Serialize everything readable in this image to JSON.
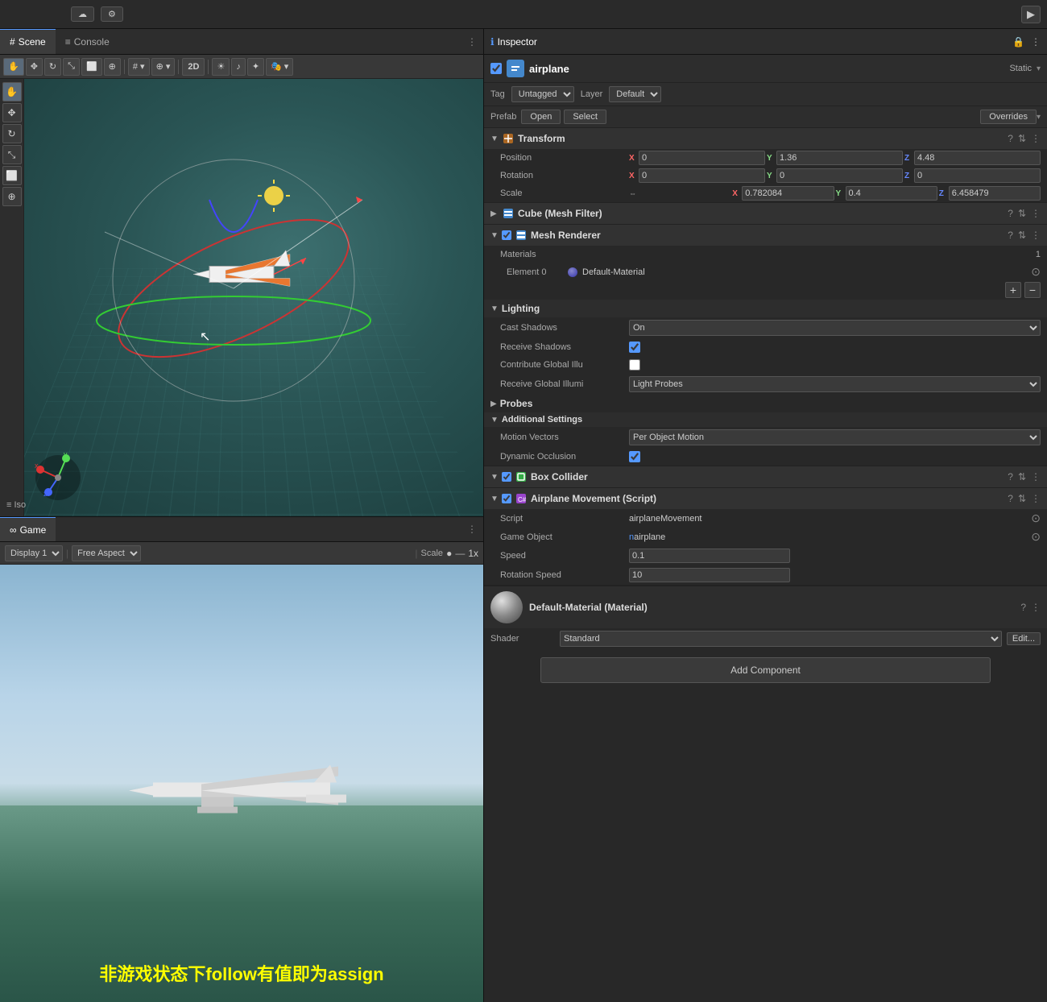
{
  "topbar": {
    "cloud_label": "☁",
    "gear_label": "⚙",
    "play_label": "▶"
  },
  "scene_tab": {
    "scene_label": "Scene",
    "console_label": "Console",
    "more_label": "⋮"
  },
  "scene_toolbar": {
    "hand_tool": "✋",
    "move_tool": "✥",
    "rotate_tool": "↻",
    "scale_tool": "⤡",
    "rect_tool": "⬜",
    "transform_tool": "⊕",
    "pivot_label": "# ▾",
    "global_label": "⊕ ▾",
    "btn_2d": "2D",
    "light_icon": "☀",
    "audio_icon": "♪",
    "fx_icon": "✦",
    "gizmos_label": "🎭 ▾"
  },
  "scene_view": {
    "iso_label": "≡ Iso"
  },
  "game_tab": {
    "game_label": "Game",
    "more_label": "⋮"
  },
  "game_toolbar": {
    "display_label": "Display 1",
    "aspect_label": "Free Aspect",
    "scale_label": "Scale",
    "scale_dot": "●",
    "scale_value": "1x"
  },
  "inspector": {
    "title": "Inspector",
    "lock_icon": "🔒",
    "menu_icon": "⋮",
    "object_name": "airplane",
    "object_checkbox": true,
    "static_label": "Static",
    "static_arrow": "▾",
    "tag_label": "Tag",
    "tag_value": "Untagged",
    "layer_label": "Layer",
    "layer_value": "Default",
    "prefab_label": "Prefab",
    "prefab_open": "Open",
    "prefab_select": "Select",
    "prefab_overrides": "Overrides",
    "transform": {
      "name": "Transform",
      "position_label": "Position",
      "pos_x": "0",
      "pos_y": "1.36",
      "pos_z": "4.48",
      "rotation_label": "Rotation",
      "rot_x": "0",
      "rot_y": "0",
      "rot_z": "0",
      "scale_label": "Scale",
      "scale_icon": "⇔",
      "scale_x": "0.782084",
      "scale_y": "0.4",
      "scale_z": "6.458479"
    },
    "cube_mesh_filter": {
      "name": "Cube (Mesh Filter)"
    },
    "mesh_renderer": {
      "name": "Mesh Renderer",
      "materials_label": "Materials",
      "materials_count": "1",
      "element_label": "Element 0",
      "material_name": "Default-Material",
      "lighting_label": "Lighting",
      "cast_shadows_label": "Cast Shadows",
      "cast_shadows_value": "On",
      "receive_shadows_label": "Receive Shadows",
      "contribute_gi_label": "Contribute Global Illu",
      "receive_gi_label": "Receive Global Illumi",
      "receive_gi_value": "Light Probes",
      "probes_label": "Probes",
      "additional_settings_label": "Additional Settings",
      "motion_vectors_label": "Motion Vectors",
      "motion_vectors_value": "Per Object Motion",
      "dynamic_occlusion_label": "Dynamic Occlusion"
    },
    "box_collider": {
      "name": "Box Collider"
    },
    "airplane_script": {
      "name": "Airplane Movement (Script)",
      "script_label": "Script",
      "script_value": "airplaneMovement",
      "gameobject_label": "Game Object",
      "gameobject_value": "airplane",
      "speed_label": "Speed",
      "speed_value": "0.1",
      "rotation_speed_label": "Rotation Speed",
      "rotation_speed_value": "10"
    },
    "default_material": {
      "name": "Default-Material (Material)",
      "type": "Material",
      "shader_label": "Shader",
      "shader_value": "Standard",
      "edit_label": "Edit..."
    },
    "add_component_label": "Add Component"
  },
  "subtitle": {
    "text": "非游戏状态下follow有值即为assign"
  }
}
